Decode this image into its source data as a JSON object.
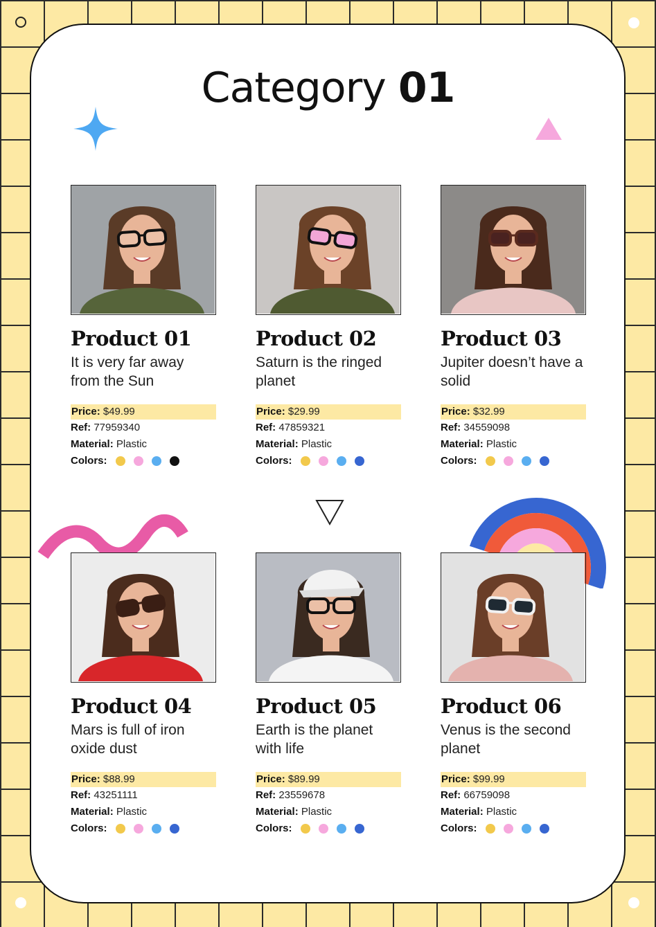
{
  "title": {
    "regular": "Category",
    "bold": "01"
  },
  "price_label": "Price:",
  "ref_label": "Ref:",
  "material_label": "Material:",
  "colors_label": "Colors:",
  "palette": {
    "background_yellow": "#FDE9A4",
    "star_blue": "#4EA8F2",
    "triangle_pink": "#F6A8DD",
    "squiggle_pink": "#E85BA6",
    "rainbow_blue": "#3766D1",
    "rainbow_orange": "#F05A3A",
    "rainbow_pink": "#F6A8DD",
    "rainbow_yellow": "#FDE9A4"
  },
  "products": [
    {
      "name": "Product 01",
      "description": "It is very far away from the Sun",
      "price": "$49.99",
      "ref": "77959340",
      "material": "Plastic",
      "colors": [
        "#F2C94C",
        "#F6A8DD",
        "#5AAEF0",
        "#111111"
      ],
      "photo": "woman-black-eyeglasses"
    },
    {
      "name": "Product 02",
      "description": "Saturn is the ringed planet",
      "price": "$29.99",
      "ref": "47859321",
      "material": "Plastic",
      "colors": [
        "#F2C94C",
        "#F6A8DD",
        "#5AAEF0",
        "#3766D1"
      ],
      "photo": "woman-pink-sunglasses"
    },
    {
      "name": "Product 03",
      "description": "Jupiter doesn’t have a solid",
      "price": "$32.99",
      "ref": "34559098",
      "material": "Plastic",
      "colors": [
        "#F2C94C",
        "#F6A8DD",
        "#5AAEF0",
        "#3766D1"
      ],
      "photo": "woman-brown-sunglasses"
    },
    {
      "name": "Product 04",
      "description": "Mars is full of iron oxide dust",
      "price": "$88.99",
      "ref": "43251111",
      "material": "Plastic",
      "colors": [
        "#F2C94C",
        "#F6A8DD",
        "#5AAEF0",
        "#3766D1"
      ],
      "photo": "woman-red-bow-sunglasses"
    },
    {
      "name": "Product 05",
      "description": "Earth is the planet with life",
      "price": "$89.99",
      "ref": "23559678",
      "material": "Plastic",
      "colors": [
        "#F2C94C",
        "#F6A8DD",
        "#5AAEF0",
        "#3766D1"
      ],
      "photo": "man-white-cap-eyeglasses"
    },
    {
      "name": "Product 06",
      "description": "Venus is the second planet",
      "price": "$99.99",
      "ref": "66759098",
      "material": "Plastic",
      "colors": [
        "#F2C94C",
        "#F6A8DD",
        "#5AAEF0",
        "#3766D1"
      ],
      "photo": "woman-white-sunglasses"
    }
  ]
}
